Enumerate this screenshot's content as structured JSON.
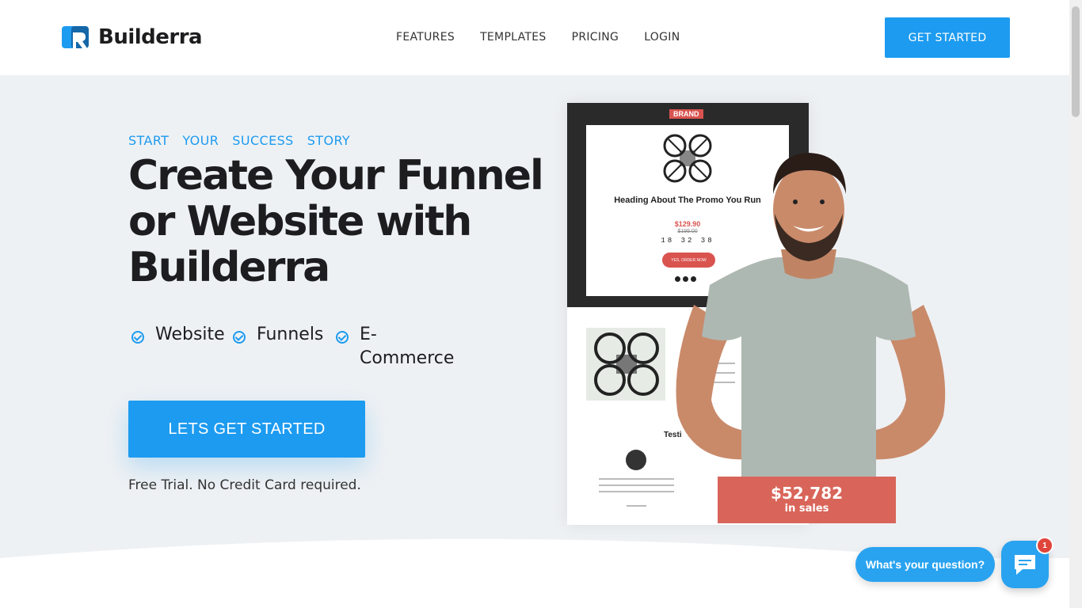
{
  "header": {
    "logo_text": "Builderra",
    "nav": [
      "FEATURES",
      "TEMPLATES",
      "PRICING",
      "LOGIN"
    ],
    "cta": "GET STARTED"
  },
  "hero": {
    "kicker": [
      "START",
      "YOUR",
      "SUCCESS",
      "STORY"
    ],
    "headline_lines": [
      "Create Your Funnel",
      "or Website with",
      "Builderra"
    ],
    "features": [
      "Website",
      "Funnels",
      "E-\nCommerce"
    ],
    "cta": "LETS GET STARTED",
    "note": "Free Trial. No Credit Card required."
  },
  "mockup": {
    "brand": "BRAND",
    "heading": "Heading About The Promo You Run",
    "price": "$129.90",
    "old_price": "$199.00",
    "timer": "18 32 38",
    "button": "YES, ORDER NOW",
    "testimonials": "Testi"
  },
  "sales": {
    "amount": "$52,782",
    "label": "in sales"
  },
  "chat": {
    "prompt": "What's your question?",
    "badge": "1"
  },
  "colors": {
    "accent": "#1d9bf0",
    "sales_bg": "#d9655a",
    "hero_bg": "#eef1f4"
  }
}
